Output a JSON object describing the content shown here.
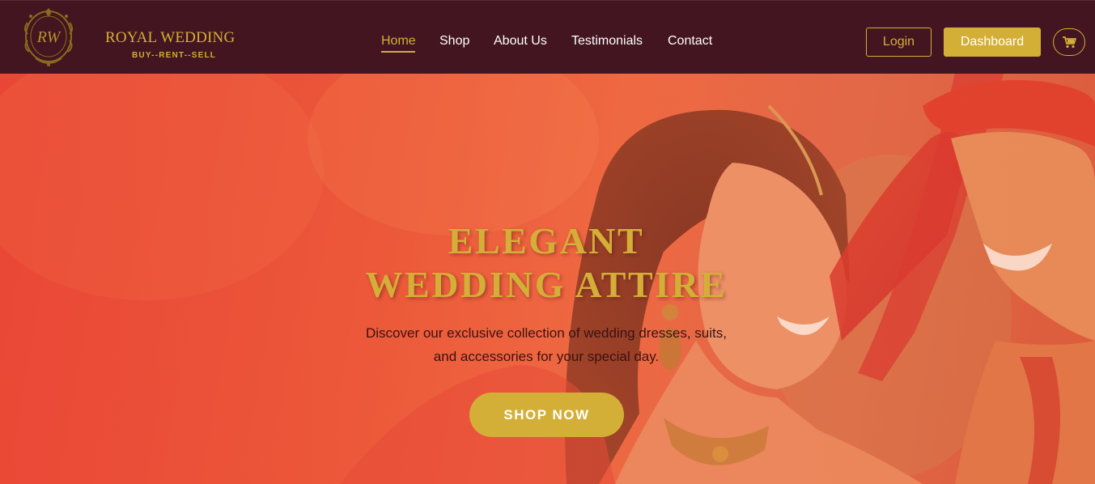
{
  "brand": {
    "monogram": "RW",
    "name": "ROYAL WEDDING",
    "tagline": "BUY--RENT--SELL"
  },
  "nav": {
    "links": [
      {
        "label": "Home",
        "active": true
      },
      {
        "label": "Shop",
        "active": false
      },
      {
        "label": "About Us",
        "active": false
      },
      {
        "label": "Testimonials",
        "active": false
      },
      {
        "label": "Contact",
        "active": false
      }
    ],
    "login_label": "Login",
    "dashboard_label": "Dashboard",
    "cart_icon": "cart-icon"
  },
  "hero": {
    "title_line1": "ELEGANT",
    "title_line2": "WEDDING ATTIRE",
    "subtitle_line1": "Discover our exclusive collection of wedding dresses, suits,",
    "subtitle_line2": "and accessories for your special day.",
    "cta_label": "SHOP NOW"
  },
  "colors": {
    "navbar_bg": "#421520",
    "gold": "#d4af37",
    "hero_red": "#e8463a",
    "text_dark": "#3a1212"
  }
}
